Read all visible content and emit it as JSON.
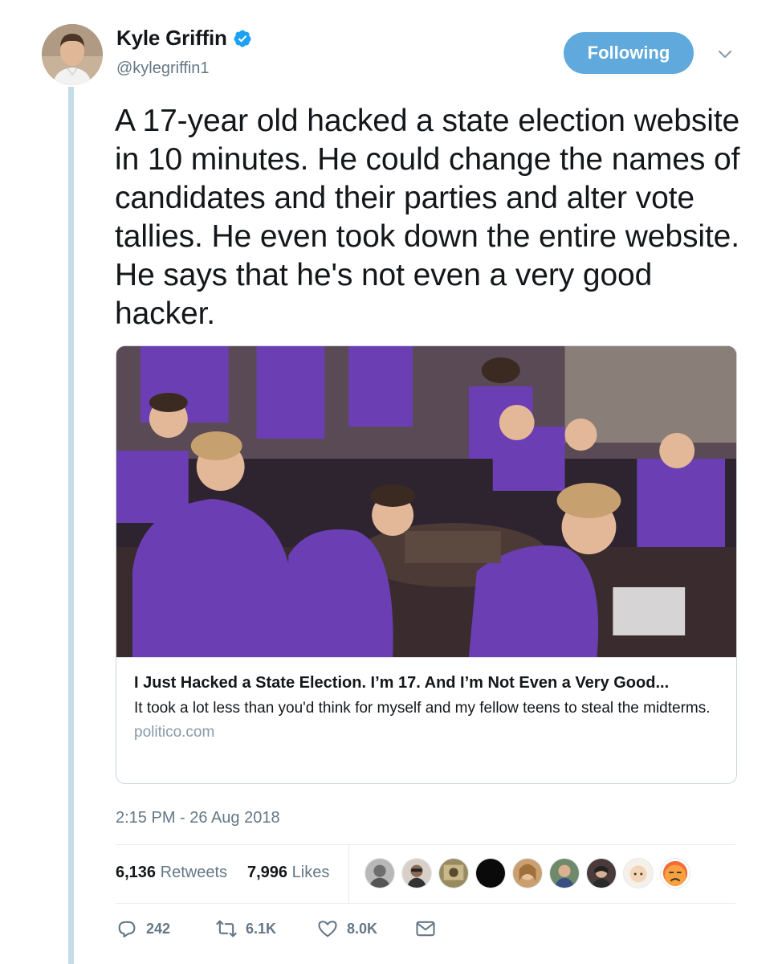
{
  "tweet": {
    "author": {
      "display_name": "Kyle Griffin",
      "handle": "@kylegriffin1",
      "verified": true
    },
    "follow_button_label": "Following",
    "text": "A 17-year old hacked a state election website in 10 minutes. He could change the names of candidates and their parties and alter vote tallies. He even took down the entire website. He says that he's not even a very good hacker.",
    "card": {
      "title": "I Just Hacked a State Election. I’m 17. And I’m Not Even a Very Good...",
      "description": "It took a lot less than you'd think for myself and my fellow teens to steal the midterms.",
      "domain": "politico.com"
    },
    "timestamp": "2:15 PM - 26 Aug 2018",
    "stats": {
      "retweets_count": "6,136",
      "retweets_label": "Retweets",
      "likes_count": "7,996",
      "likes_label": "Likes"
    },
    "actions": {
      "reply_count": "242",
      "retweet_count": "6.1K",
      "like_count": "8.0K"
    }
  },
  "colors": {
    "accent": "#5fa9dd",
    "thread_line": "#c4dbe8",
    "secondary_text": "#657786",
    "card_border": "#ccd6dd"
  },
  "icons": [
    "verified-badge-icon",
    "chevron-down-icon",
    "reply-icon",
    "retweet-icon",
    "heart-icon",
    "direct-message-icon"
  ]
}
